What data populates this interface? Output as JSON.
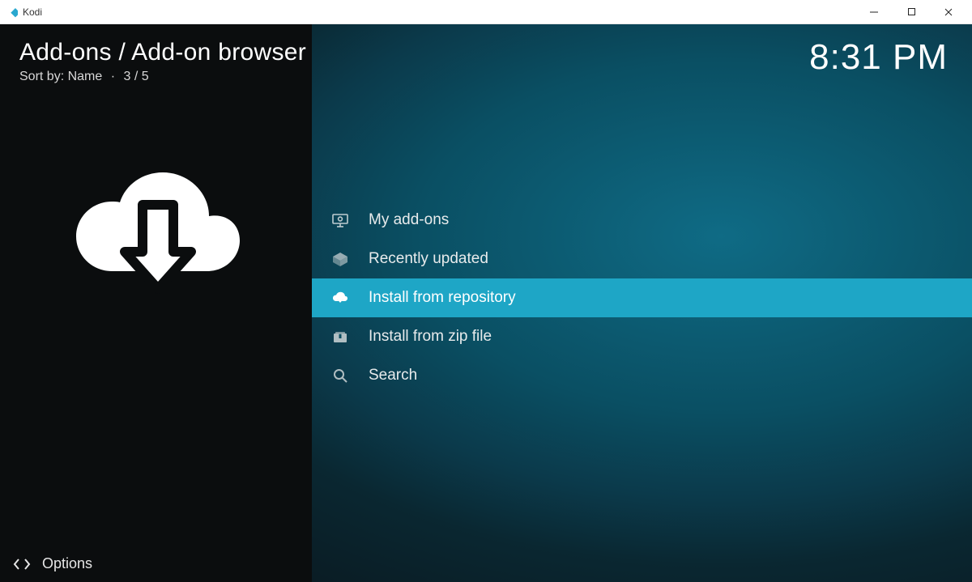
{
  "window": {
    "app_title": "Kodi"
  },
  "header": {
    "breadcrumb": "Add-ons / Add-on browser",
    "sort_label": "Sort by: Name",
    "position": "3 / 5",
    "clock": "8:31 PM"
  },
  "sidebar": {
    "cloud_icon": "download-cloud-icon",
    "options_label": "Options"
  },
  "menu": {
    "items": [
      {
        "icon": "monitor-icon",
        "label": "My add-ons",
        "selected": false
      },
      {
        "icon": "box-open-icon",
        "label": "Recently updated",
        "selected": false
      },
      {
        "icon": "cloud-download-icon",
        "label": "Install from repository",
        "selected": true
      },
      {
        "icon": "zip-file-icon",
        "label": "Install from zip file",
        "selected": false
      },
      {
        "icon": "search-icon",
        "label": "Search",
        "selected": false
      }
    ]
  }
}
